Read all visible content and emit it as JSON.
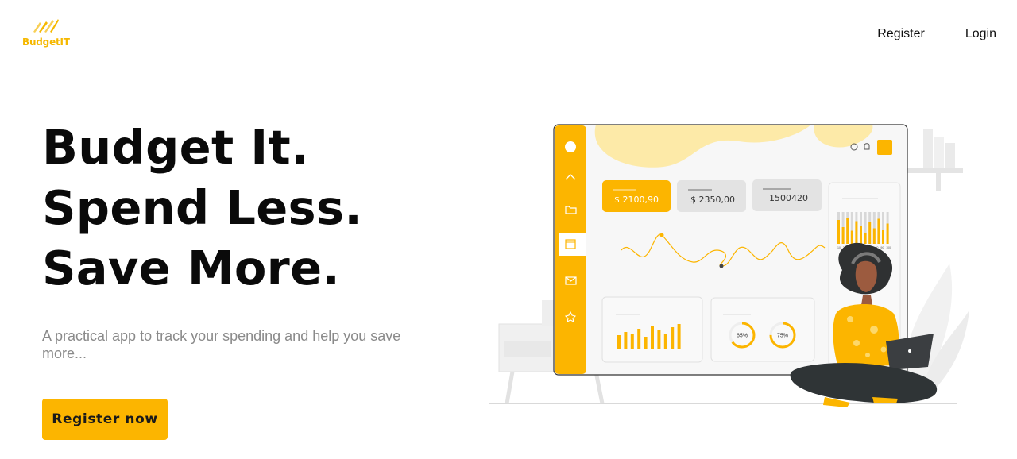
{
  "brand": {
    "name": "BudgetIT",
    "accent": "#fcb500"
  },
  "nav": {
    "register": "Register",
    "login": "Login"
  },
  "hero": {
    "line1": "Budget It.",
    "line2": "Spend Less.",
    "line3": "Save More.",
    "tagline": "A practical app to track your spending and help you save more...",
    "cta": "Register now"
  },
  "illustration": {
    "cards": [
      "$ 2100,90",
      "$ 2350,00",
      "1500420"
    ],
    "donuts": [
      {
        "label": "65%",
        "value": 0.65
      },
      {
        "label": "75%",
        "value": 0.75
      }
    ],
    "sidebar_icons": [
      "profile-icon",
      "chevron-up-icon",
      "folder-icon",
      "calendar-icon",
      "mail-icon",
      "star-icon"
    ],
    "top_icons": [
      "smiley-icon",
      "bell-icon",
      "avatar-square-icon"
    ],
    "mini_axis": [
      "10",
      "20",
      "30",
      "40",
      "50",
      "60",
      "70",
      "80",
      "90",
      "100"
    ]
  }
}
